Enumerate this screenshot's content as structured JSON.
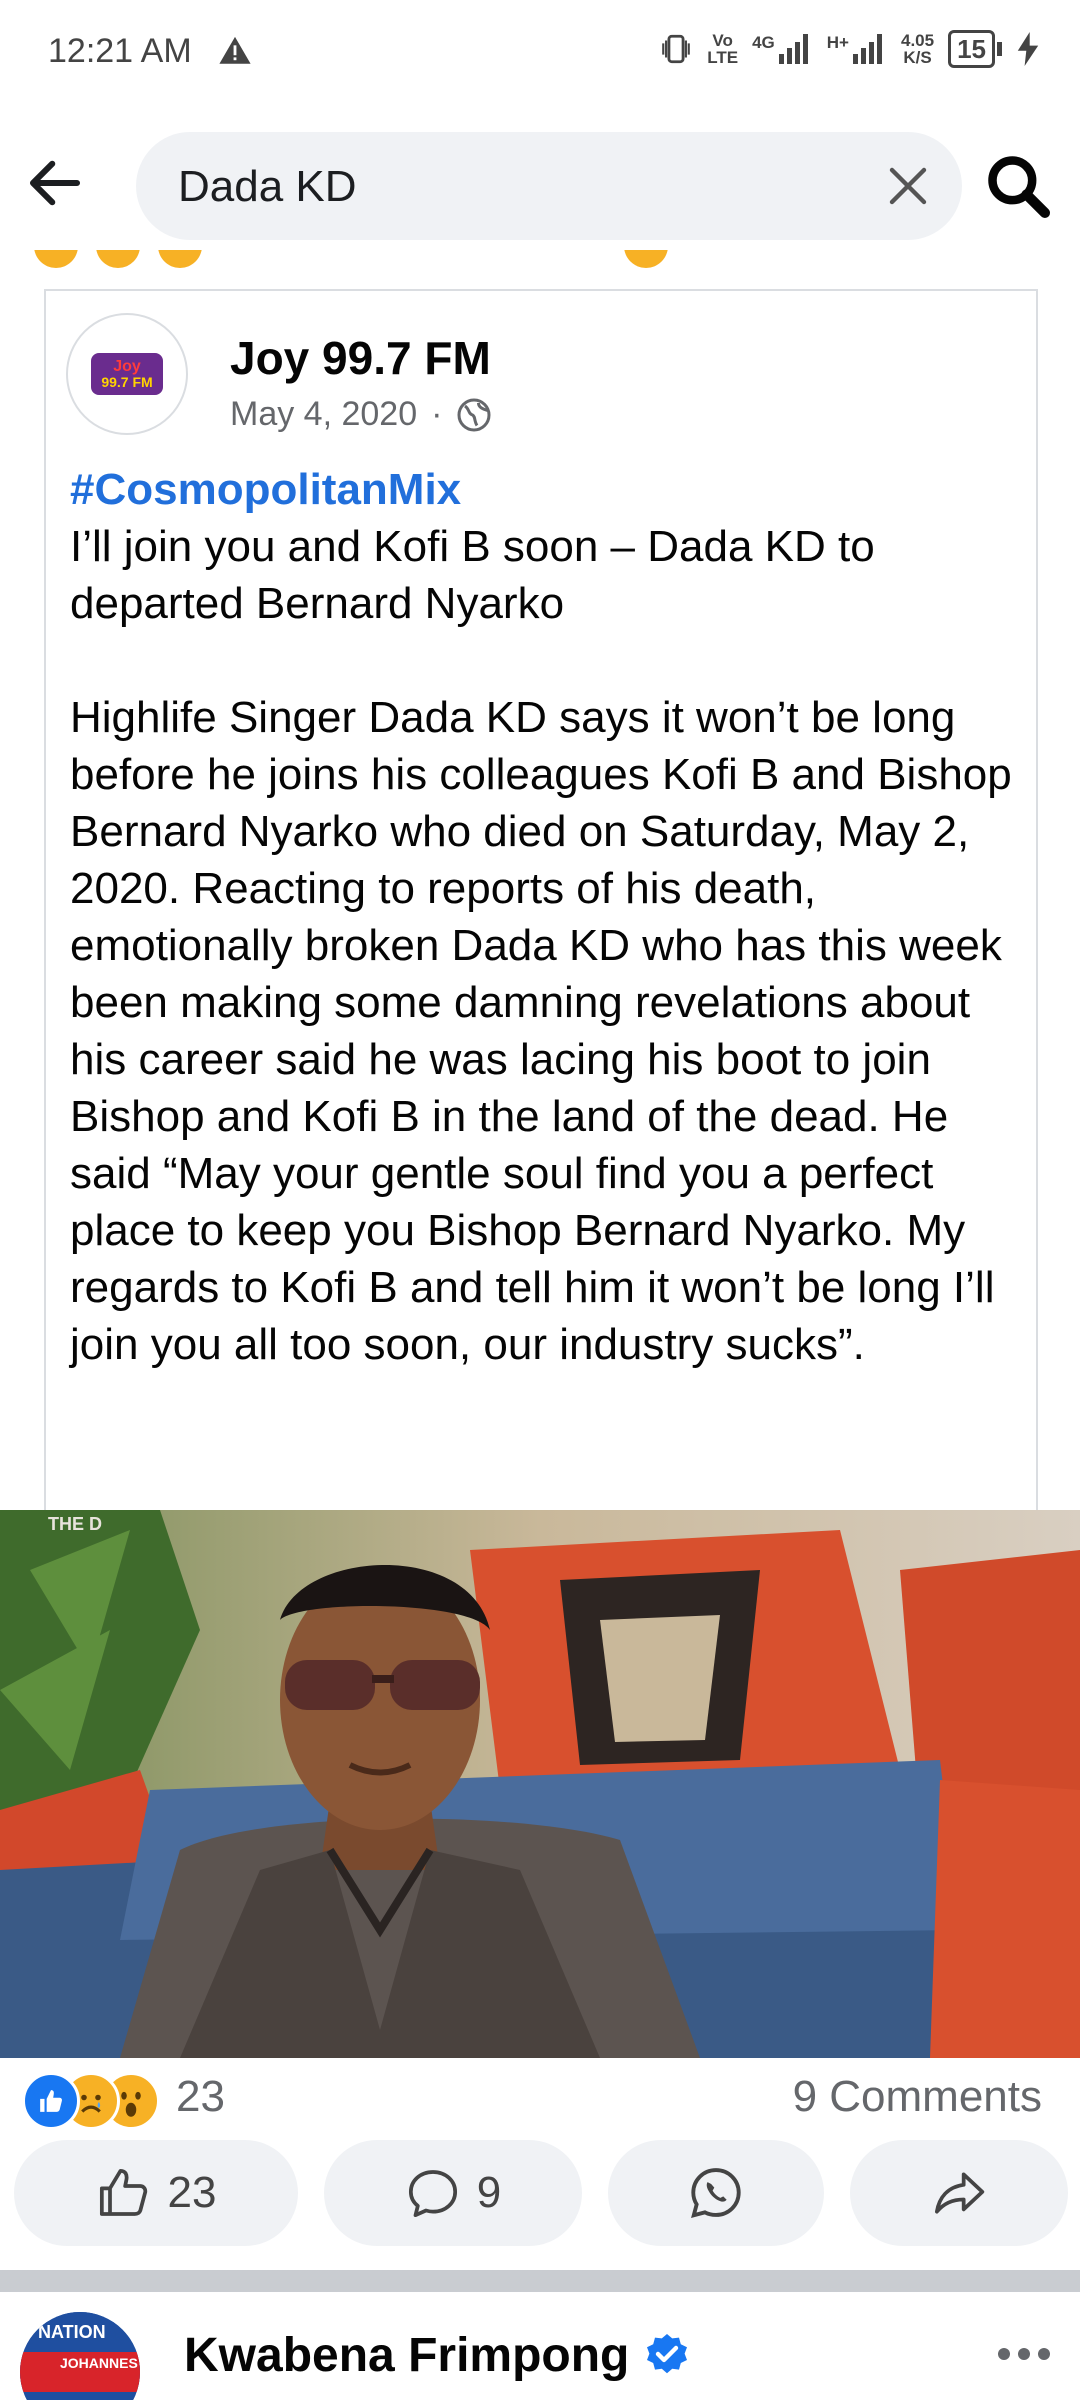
{
  "status_bar": {
    "time": "12:21 AM",
    "volte": "Vo\nLTE",
    "net1": "4G",
    "net2": "H+",
    "speed_value": "4.05",
    "speed_unit": "K/S",
    "battery": "15"
  },
  "search": {
    "query": "Dada KD"
  },
  "post": {
    "page_name": "Joy 99.7 FM",
    "date": "May 4, 2020",
    "separator": "·",
    "avatar_logo_line1": "Joy",
    "avatar_logo_line2": "99.7 FM",
    "hashtag": "#CosmopolitanMix",
    "headline": "I’ll join you and Kofi B soon – Dada KD to departed Bernard Nyarko",
    "body": "Highlife Singer Dada KD says it won’t be long before he joins his colleagues Kofi B and Bishop Bernard Nyarko who died on Saturday, May 2, 2020. Reacting to reports of his death, emotionally broken Dada KD who has this week been making some damning revelations about his career said he was lacing his boot to join Bishop and Kofi B in the land of the dead. He said “May your gentle soul find you a perfect place to keep you Bishop Bernard Nyarko. My regards to Kofi B and tell him it won’t be long I’ll join you all too soon, our industry sucks”.",
    "image_watermark": "THE D",
    "reaction_count": "23",
    "comments_label": "9 Comments",
    "like_count": "23",
    "comment_count": "9"
  },
  "next_post": {
    "author": "Kwabena Frimpong",
    "avatar_text1": "NATION",
    "avatar_text2": "JOHANNES"
  },
  "colors": {
    "accent_blue": "#1877f2",
    "hashtag_blue": "#216fdb",
    "surface_gray": "#f0f2f5"
  }
}
